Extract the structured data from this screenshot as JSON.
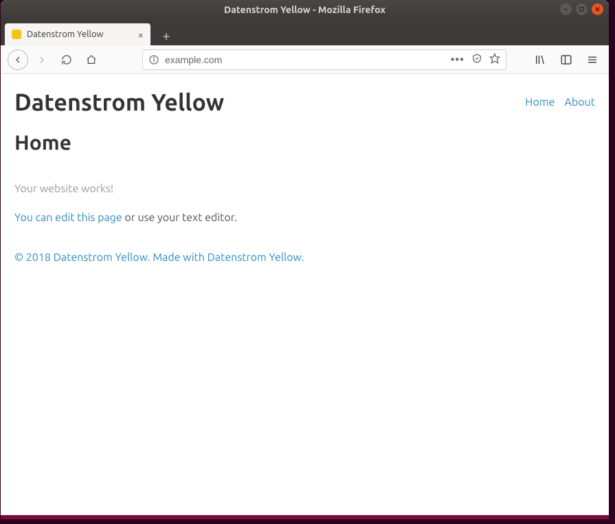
{
  "window": {
    "title": "Datenstrom Yellow - Mozilla Firefox"
  },
  "tabs": {
    "active": {
      "label": "Datenstrom Yellow"
    }
  },
  "urlbar": {
    "value": "example.com"
  },
  "page": {
    "site_title": "Datenstrom Yellow",
    "nav": {
      "home": "Home",
      "about": "About"
    },
    "heading": "Home",
    "intro": "Your website works!",
    "edit_link": "You can edit this page",
    "edit_rest": " or use your text editor.",
    "footer_copyright": "© 2018 Datenstrom Yellow.",
    "footer_madewith": "Made with Datenstrom Yellow."
  }
}
